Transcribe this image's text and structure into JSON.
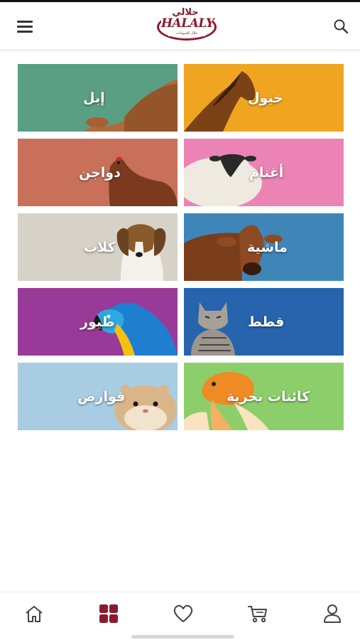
{
  "header": {
    "logo_arabic": "حلالي",
    "logo_main": "HALALY",
    "logo_sub": "حلال للحيوانات"
  },
  "categories": [
    {
      "label": "إبل",
      "bg": "#5a9f83"
    },
    {
      "label": "خيول",
      "bg": "#f0a520"
    },
    {
      "label": "دواجن",
      "bg": "#c8705a"
    },
    {
      "label": "أغنام",
      "bg": "#ec83b5"
    },
    {
      "label": "كلاب",
      "bg": "#d6d2c8"
    },
    {
      "label": "ماشية",
      "bg": "#3e86b8"
    },
    {
      "label": "طيور",
      "bg": "#9a3a98"
    },
    {
      "label": "قطط",
      "bg": "#2764ad"
    },
    {
      "label": "قوارض",
      "bg": "#a8cce2"
    },
    {
      "label": "كائنات بحرية",
      "bg": "#8ccf6a"
    }
  ],
  "tabbar": {
    "active_color": "#8c1b2d",
    "icon_color": "#444444",
    "items": [
      "home-icon",
      "categories-icon",
      "heart-icon",
      "cart-icon",
      "user-icon"
    ]
  }
}
